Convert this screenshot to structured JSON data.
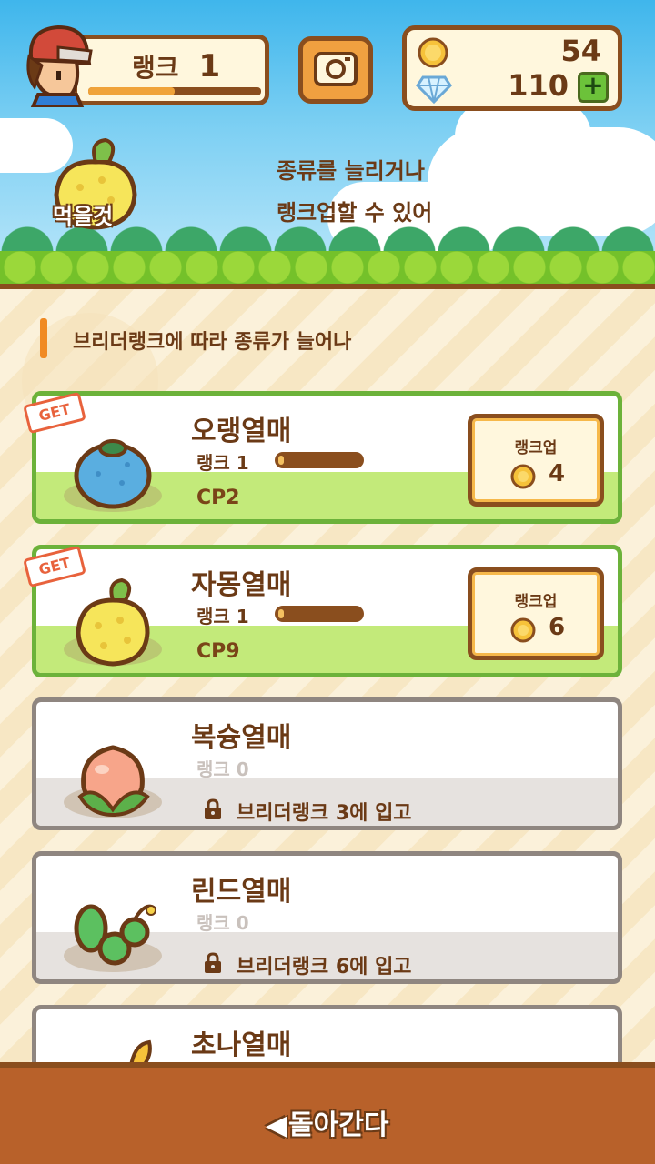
{
  "header": {
    "player_rank_label": "랭크",
    "player_rank_value": "1",
    "player_rank_progress": 0.5,
    "coins": "54",
    "gems": "110",
    "plus_label": "+",
    "food_label": "먹을것",
    "hint_line1": "종류를 늘리거나",
    "hint_line2": "랭크업할 수 있어"
  },
  "section": {
    "heading": "브리더랭크에 따라 종류가 늘어나"
  },
  "berries": [
    {
      "name": "오랭열매",
      "rank_text": "랭크 1",
      "cp": "CP2",
      "tag": "GET",
      "button_label": "랭크업",
      "cost": "4",
      "icon": "oran-berry-icon"
    },
    {
      "name": "자몽열매",
      "rank_text": "랭크 1",
      "cp": "CP9",
      "tag": "GET",
      "button_label": "랭크업",
      "cost": "6",
      "icon": "sitrus-berry-icon"
    },
    {
      "name": "복슝열매",
      "rank_text": "랭크 0",
      "lock_text": "브리더랭크 3에 입고",
      "icon": "pecha-berry-icon"
    },
    {
      "name": "린드열매",
      "rank_text": "랭크 0",
      "lock_text": "브리더랭크 6에 입고",
      "icon": "rindo-berry-icon"
    },
    {
      "name": "초나열매",
      "icon": "chople-berry-icon"
    }
  ],
  "footer": {
    "back_arrow": "◀",
    "back_label": "돌아간다"
  },
  "colors": {
    "border_brown": "#8a4e1e",
    "owned_green": "#6cb23a",
    "accent_orange": "#f08a23"
  }
}
